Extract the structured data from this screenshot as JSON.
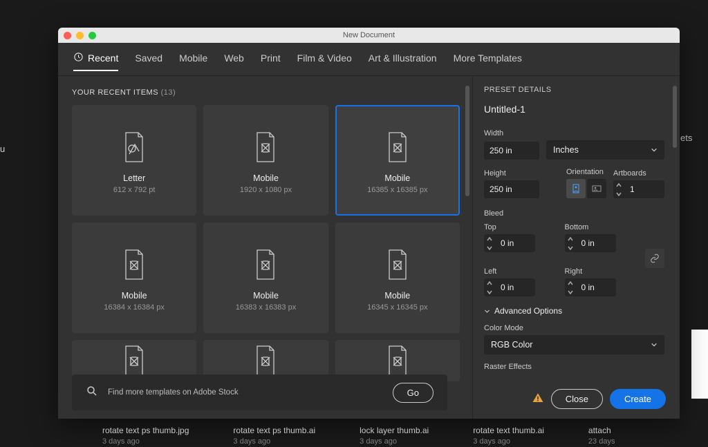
{
  "window_title": "New Document",
  "tabs": [
    "Recent",
    "Saved",
    "Mobile",
    "Web",
    "Print",
    "Film & Video",
    "Art & Illustration",
    "More Templates"
  ],
  "section": {
    "label": "YOUR RECENT ITEMS",
    "count": "(13)"
  },
  "cards": [
    {
      "name": "Letter",
      "dim": "612 x 792 pt",
      "icon": "letter"
    },
    {
      "name": "Mobile",
      "dim": "1920 x 1080 px",
      "icon": "tools"
    },
    {
      "name": "Mobile",
      "dim": "16385 x 16385 px",
      "icon": "tools",
      "selected": true
    },
    {
      "name": "Mobile",
      "dim": "16384 x 16384 px",
      "icon": "tools"
    },
    {
      "name": "Mobile",
      "dim": "16383 x 16383 px",
      "icon": "tools"
    },
    {
      "name": "Mobile",
      "dim": "16345 x 16345 px",
      "icon": "tools"
    }
  ],
  "stock": {
    "placeholder": "Find more templates on Adobe Stock",
    "go": "Go"
  },
  "preset": {
    "heading": "PRESET DETAILS",
    "name": "Untitled-1",
    "width_label": "Width",
    "width": "250 in",
    "units": "Inches",
    "height_label": "Height",
    "height": "250 in",
    "orientation_label": "Orientation",
    "artboards_label": "Artboards",
    "artboards": "1",
    "bleed_label": "Bleed",
    "top_label": "Top",
    "top": "0 in",
    "bottom_label": "Bottom",
    "bottom": "0 in",
    "left_label": "Left",
    "left": "0 in",
    "right_label": "Right",
    "right": "0 in",
    "advanced": "Advanced Options",
    "color_mode_label": "Color Mode",
    "color_mode": "RGB Color",
    "raster_label": "Raster Effects"
  },
  "buttons": {
    "close": "Close",
    "create": "Create"
  },
  "bg_files": [
    {
      "name": "rotate text ps thumb.jpg",
      "date": "3 days ago"
    },
    {
      "name": "rotate text ps thumb.ai",
      "date": "3 days ago"
    },
    {
      "name": "lock layer thumb.ai",
      "date": "3 days ago"
    },
    {
      "name": "rotate text thumb.ai",
      "date": "3 days ago"
    },
    {
      "name": "attach",
      "date": "23 days"
    }
  ]
}
